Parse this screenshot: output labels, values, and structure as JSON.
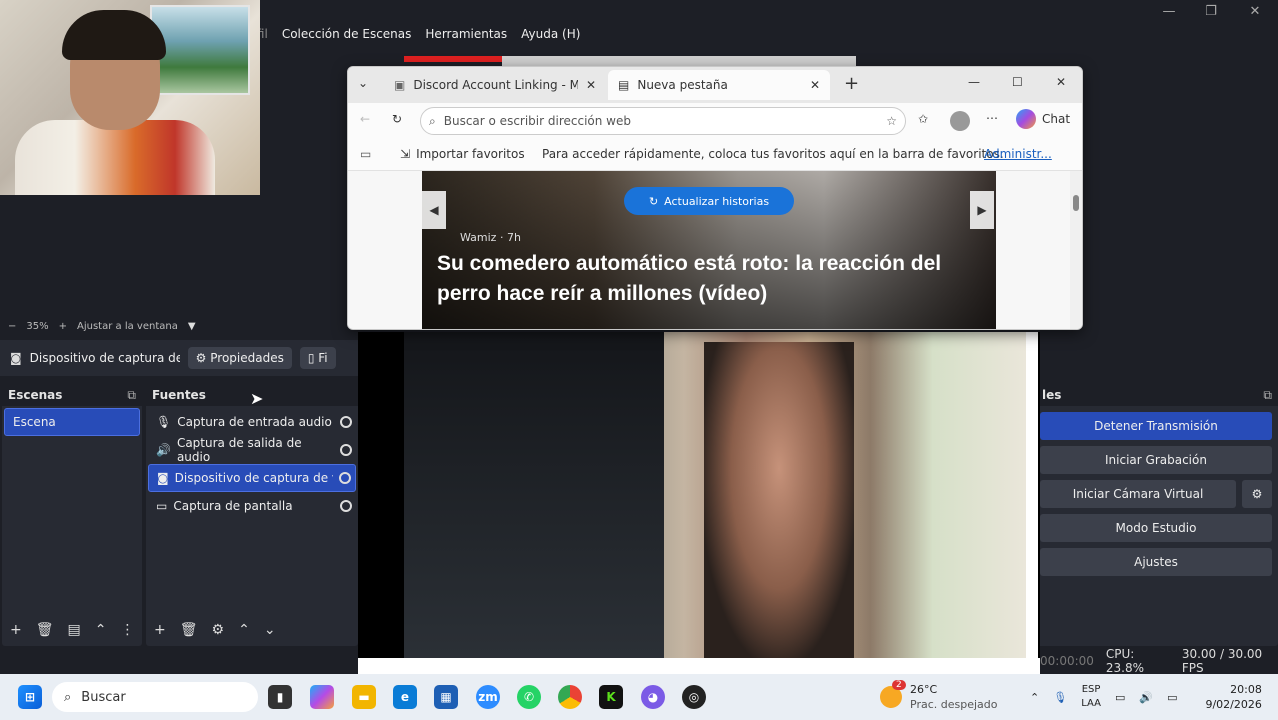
{
  "obs": {
    "menu": [
      "rfil",
      "Colección de Escenas",
      "Herramientas",
      "Ayuda (H)"
    ],
    "zoom": {
      "minus": "−",
      "value": "35%",
      "plus": "+",
      "fit": "Ajustar a la ventana"
    },
    "source_bar": {
      "source_name": "Dispositivo de captura de v",
      "properties": "Propiedades",
      "filters": "Fi"
    },
    "scenes": {
      "title": "Escenas",
      "items": [
        "Escena"
      ]
    },
    "sources": {
      "title": "Fuentes",
      "items": [
        "Captura de entrada audio",
        "Captura de salida de audio",
        "Dispositivo de captura de víd",
        "Captura de pantalla"
      ]
    },
    "controls": {
      "title": "les",
      "stop_stream": "Detener Transmisión",
      "start_rec": "Iniciar Grabación",
      "virtual_cam": "Iniciar Cámara Virtual",
      "studio": "Modo Estudio",
      "settings": "Ajustes"
    },
    "status": {
      "time": "00:00:00",
      "cpu": "CPU: 23.8%",
      "fps": "30.00 / 30.00 FPS"
    }
  },
  "browser": {
    "tabs": [
      {
        "label": "Discord Account Linking - Marvel R"
      },
      {
        "label": "Nueva pestaña"
      }
    ],
    "address_placeholder": "Buscar o escribir dirección web",
    "chat": "Chat",
    "favbar": {
      "import": "Importar favoritos",
      "message": "Para acceder rápidamente, coloca tus favoritos aquí en la barra de favoritos.",
      "manage": "Administr..."
    },
    "news": {
      "update": "Actualizar historias",
      "source": "Wamiz · 7h",
      "title": "Su comedero automático está roto: la reacción del perro hace reír a millones (vídeo)"
    }
  },
  "taskbar": {
    "search": "Buscar",
    "weather": {
      "temp": "26°C",
      "desc": "Prac. despejado",
      "badge": "2"
    },
    "lang": {
      "line1": "ESP",
      "line2": "LAA"
    },
    "clock": {
      "time": "20:08",
      "date": "9/02/2026"
    }
  },
  "colors": {
    "accent": "#284cb8",
    "browser_button": "#1a73d9"
  }
}
